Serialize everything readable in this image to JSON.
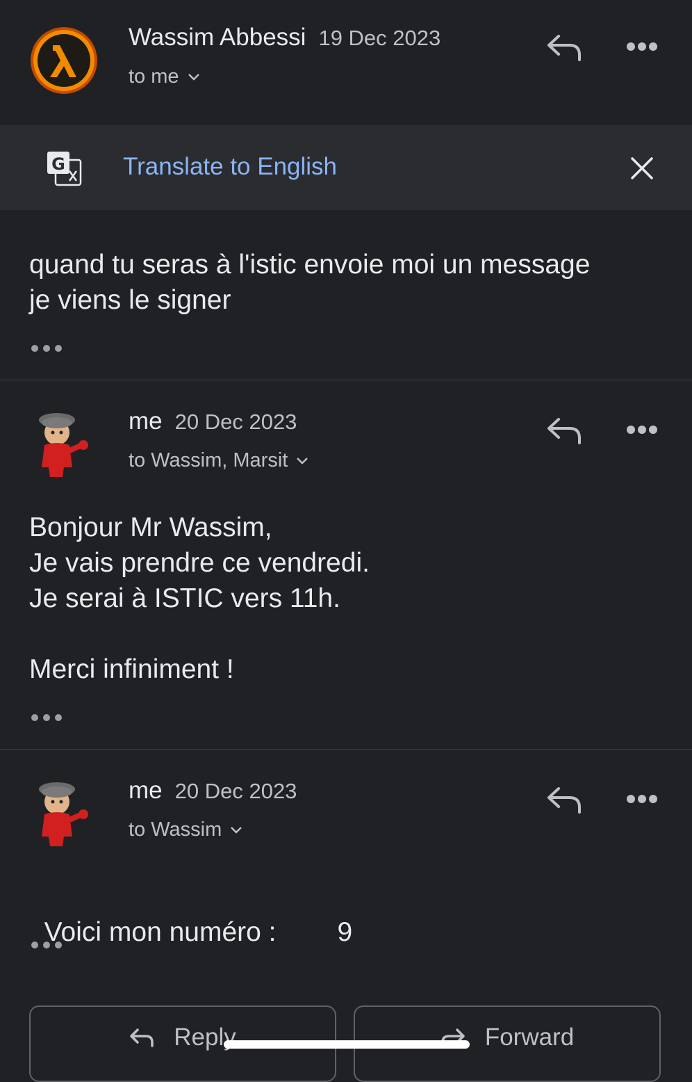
{
  "messages": [
    {
      "sender": "Wassim Abbessi",
      "date": "19 Dec 2023",
      "recipients": "to me",
      "body": "quand tu seras à l'istic envoie moi un message\nje viens le signer"
    },
    {
      "sender": "me",
      "date": "20 Dec 2023",
      "recipients": "to Wassim, Marsit",
      "body": "Bonjour Mr Wassim,\nJe vais prendre ce vendredi.\nJe serai à ISTIC vers 11h.\n\nMerci infiniment !"
    },
    {
      "sender": "me",
      "date": "20 Dec 2023",
      "recipients": "to Wassim",
      "body_prefix": "Voici mon numéro :",
      "body_number": "9"
    }
  ],
  "translate": {
    "label": "Translate to English"
  },
  "actions": {
    "reply": "Reply",
    "forward": "Forward"
  },
  "icons": [
    "lambda-logo-avatar",
    "cartoon-avatar",
    "reply-icon",
    "more-options-icon",
    "translate-icon",
    "close-icon",
    "chevron-down-icon",
    "forward-icon"
  ],
  "colors": {
    "background": "#202124",
    "translate_bar": "#2b2c2f",
    "link": "#8ab4f8",
    "accent_orange": "#f28b00"
  }
}
